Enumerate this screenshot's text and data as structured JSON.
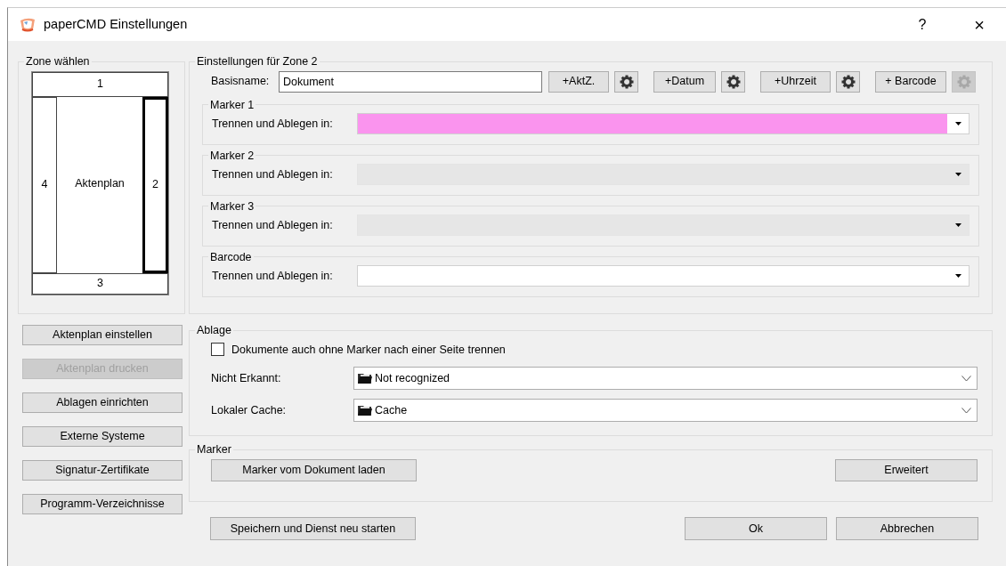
{
  "window": {
    "title": "paperCMD Einstellungen",
    "help": "?",
    "close": "×"
  },
  "zone_group": {
    "title": "Zone wählen",
    "center_label": "Aktenplan",
    "zones": [
      {
        "label": "1",
        "selected": false
      },
      {
        "label": "2",
        "selected": true
      },
      {
        "label": "3",
        "selected": false
      },
      {
        "label": "4",
        "selected": false
      }
    ]
  },
  "side_buttons": [
    {
      "label": "Aktenplan einstellen",
      "disabled": false
    },
    {
      "label": "Aktenplan drucken",
      "disabled": true
    },
    {
      "label": "Ablagen einrichten",
      "disabled": false
    },
    {
      "label": "Externe Systeme",
      "disabled": false
    },
    {
      "label": "Signatur-Zertifikate",
      "disabled": false
    },
    {
      "label": "Programm-Verzeichnisse",
      "disabled": false
    }
  ],
  "zone_settings": {
    "title": "Einstellungen für Zone 2",
    "basename_label": "Basisname:",
    "basename_value": "Dokument",
    "insert_buttons": [
      {
        "label": "+AktZ.",
        "gear_disabled": false
      },
      {
        "label": "+Datum",
        "gear_disabled": false
      },
      {
        "label": "+Uhrzeit",
        "gear_disabled": false
      },
      {
        "label": "+ Barcode",
        "gear_disabled": true
      }
    ],
    "markers": [
      {
        "title": "Marker 1",
        "label": "Trennen und Ablegen in:",
        "disabled": false,
        "color": "#fa94ee"
      },
      {
        "title": "Marker 2",
        "label": "Trennen und Ablegen in:",
        "disabled": true
      },
      {
        "title": "Marker 3",
        "label": "Trennen und Ablegen in:",
        "disabled": true
      },
      {
        "title": "Barcode",
        "label": "Trennen und Ablegen in:",
        "disabled": false
      }
    ]
  },
  "ablage": {
    "title": "Ablage",
    "checkbox": {
      "label": "Dokumente auch ohne Marker nach einer Seite trennen",
      "checked": false
    },
    "rows": [
      {
        "label": "Nicht Erkannt:",
        "value": "Not recognized"
      },
      {
        "label": "Lokaler Cache:",
        "value": "Cache"
      }
    ]
  },
  "marker_group": {
    "title": "Marker",
    "load_button": "Marker vom Dokument laden",
    "advanced_button": "Erweitert"
  },
  "footer": {
    "save_button": "Speichern und Dienst neu starten",
    "ok_button": "Ok",
    "cancel_button": "Abbrechen"
  }
}
